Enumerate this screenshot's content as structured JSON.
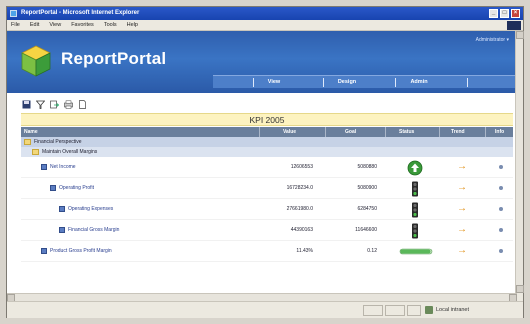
{
  "window": {
    "title": "ReportPortal - Microsoft Internet Explorer",
    "menu": [
      "File",
      "Edit",
      "View",
      "Favorites",
      "Tools",
      "Help"
    ]
  },
  "app": {
    "name": "ReportPortal",
    "user": "Administrator ▾",
    "nav": [
      "View",
      "Design",
      "Admin"
    ]
  },
  "toolbar": [
    "save-icon",
    "filter-icon",
    "export-icon",
    "print-icon",
    "new-icon"
  ],
  "report": {
    "title": "KPI 2005",
    "columns": [
      "Name",
      "Value",
      "Goal",
      "Status",
      "Trend",
      "Info"
    ],
    "groups": [
      {
        "label": "Financial Perspective"
      },
      {
        "label": "Maintain Overall Margins"
      }
    ],
    "rows": [
      {
        "name": "Net Income",
        "value": "12606553",
        "goal": "5080880",
        "status": "green-up",
        "trend": "→",
        "level": 1
      },
      {
        "name": "Operating Profit",
        "value": "16728234.0",
        "goal": "5080900",
        "status": "traffic-light",
        "trend": "→",
        "level": 2
      },
      {
        "name": "Operating Expenses",
        "value": "27661980.0",
        "goal": "6284750",
        "status": "traffic-light",
        "trend": "→",
        "level": 3
      },
      {
        "name": "Financial Gross Margin",
        "value": "44390163",
        "goal": "11646600",
        "status": "traffic-light",
        "trend": "→",
        "level": 3
      },
      {
        "name": "Product Gross Profit Margin",
        "value": "11.43%",
        "goal": "0.12",
        "status": "progress-bar",
        "trend": "→",
        "level": 1
      }
    ]
  },
  "statusbar": {
    "zone": "Local intranet"
  },
  "colors": {
    "banner": "#2f5fae",
    "header": "#6a7f9c",
    "kpi_title_bg": "#fdf3c0",
    "trend": "#e08d10",
    "status_green": "#3a9a3a"
  }
}
